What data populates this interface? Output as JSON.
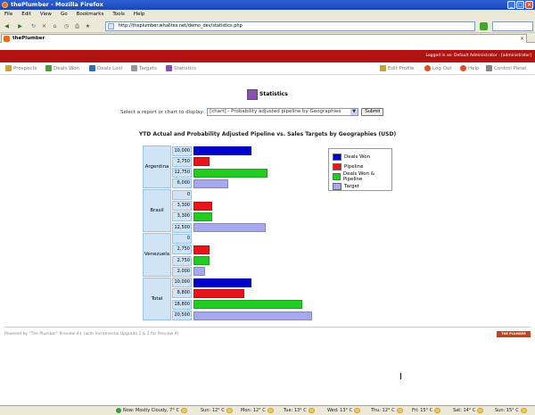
{
  "window": {
    "title": "thePlumber - Mozilla Firefox",
    "buttons": [
      "_",
      "□",
      "×"
    ]
  },
  "menu": [
    "File",
    "Edit",
    "View",
    "Go",
    "Bookmarks",
    "Tools",
    "Help"
  ],
  "address": {
    "url": "http://theplumber.whalites.net/demo_dev/statistics.php"
  },
  "tab": {
    "label": "thePlumber"
  },
  "app": {
    "logged_in": "Logged in as: Default Administrator - [administrator]",
    "nav_left": [
      "Prospects",
      "Deals Won",
      "Deals Lost",
      "Targets",
      "Statistics"
    ],
    "nav_right": [
      "Edit Profile",
      "Log Out",
      "Help",
      "Control Panel"
    ]
  },
  "page": {
    "title": "Statistics",
    "selector_label": "Select a report or chart to display:",
    "selected_report": "[chart] - Probability adjusted pipeline by Geographies",
    "submit_label": "Submit"
  },
  "chart_data": {
    "type": "bar",
    "title": "YTD Actual and Probability Adjusted Pipeline vs. Sales Targets by Geographies (USD)",
    "categories": [
      "Argentina",
      "Brasil",
      "Venezuela",
      "Total"
    ],
    "series": [
      {
        "name": "Deals Won",
        "color": "#0000cc",
        "values": [
          10000,
          0,
          0,
          10000
        ],
        "labels": [
          "10,000",
          "0",
          "0",
          "10,000"
        ]
      },
      {
        "name": "Pipeline",
        "color": "#e8141b",
        "values": [
          2750,
          3300,
          2750,
          8800
        ],
        "labels": [
          "2,750",
          "3,300",
          "2,750",
          "8,800"
        ]
      },
      {
        "name": "Deals Won & Pipeline",
        "color": "#22cc22",
        "values": [
          12750,
          3300,
          2750,
          18800
        ],
        "labels": [
          "12,750",
          "3,300",
          "2,750",
          "18,800"
        ]
      },
      {
        "name": "Target",
        "color": "#a8a8ee",
        "values": [
          6000,
          12500,
          2000,
          20500
        ],
        "labels": [
          "6,000",
          "12,500",
          "2,000",
          "20,500"
        ]
      }
    ],
    "orientation": "horizontal",
    "legend": "top-right",
    "xlim": [
      0,
      20500
    ]
  },
  "footer": {
    "text": "Powered by \"The Plumber\" Preview-4+ (with Incremental Upgrade 1 & 2 for Preview 4)",
    "logo": "THE PLUMBER"
  },
  "statusbar": [
    "Now: Mostly Cloudy, 7° C",
    "Sun: 12° C",
    "Mon: 12° C",
    "Tue: 13° C",
    "Wed: 13° C",
    "Thu: 12° C",
    "Fri: 15° C",
    "Sat: 14° C",
    "Sun: 15° C"
  ]
}
